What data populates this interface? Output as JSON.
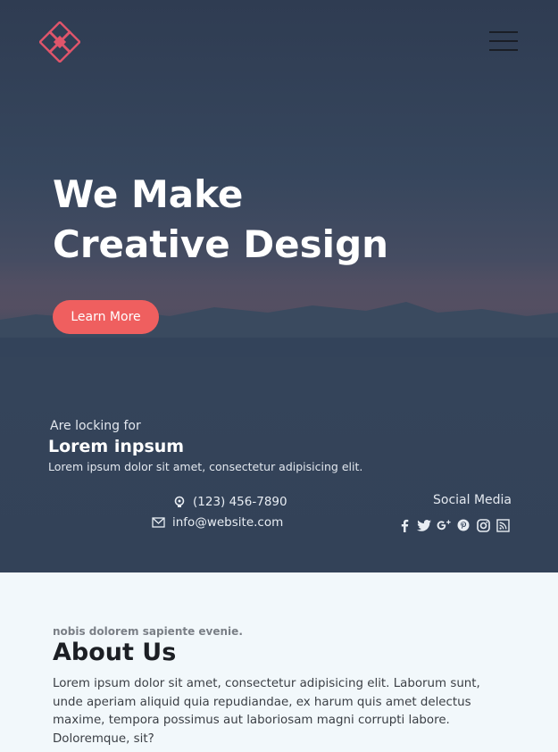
{
  "header": {
    "logo_icon": "diamond-flower-logo-icon",
    "menu_icon": "hamburger-menu-icon"
  },
  "hero": {
    "title_line1": "We Make",
    "title_line2": "Creative Design",
    "button_label": "Learn More",
    "accent_color": "#ef5f5f"
  },
  "info": {
    "looking_for": "Are locking for",
    "title": "Lorem inpsum",
    "text": "Lorem ipsum dolor sit amet, consectetur adipisicing elit."
  },
  "contact": {
    "phone": "(123) 456-7890",
    "email": "info@website.com"
  },
  "social": {
    "label": "Social Media",
    "icons": [
      "facebook-icon",
      "twitter-icon",
      "google-plus-icon",
      "pinterest-icon",
      "instagram-icon",
      "rss-icon"
    ]
  },
  "about": {
    "kicker": "nobis dolorem sapiente evenie.",
    "title": "About Us",
    "text": "Lorem ipsum dolor sit amet, consectetur adipisicing elit. Laborum sunt, unde aperiam aliquid quia repudiandae, ex harum quis amet delectus maxime, tempora possimus aut laboriosam magni corrupti labore. Doloremque, sit?"
  }
}
